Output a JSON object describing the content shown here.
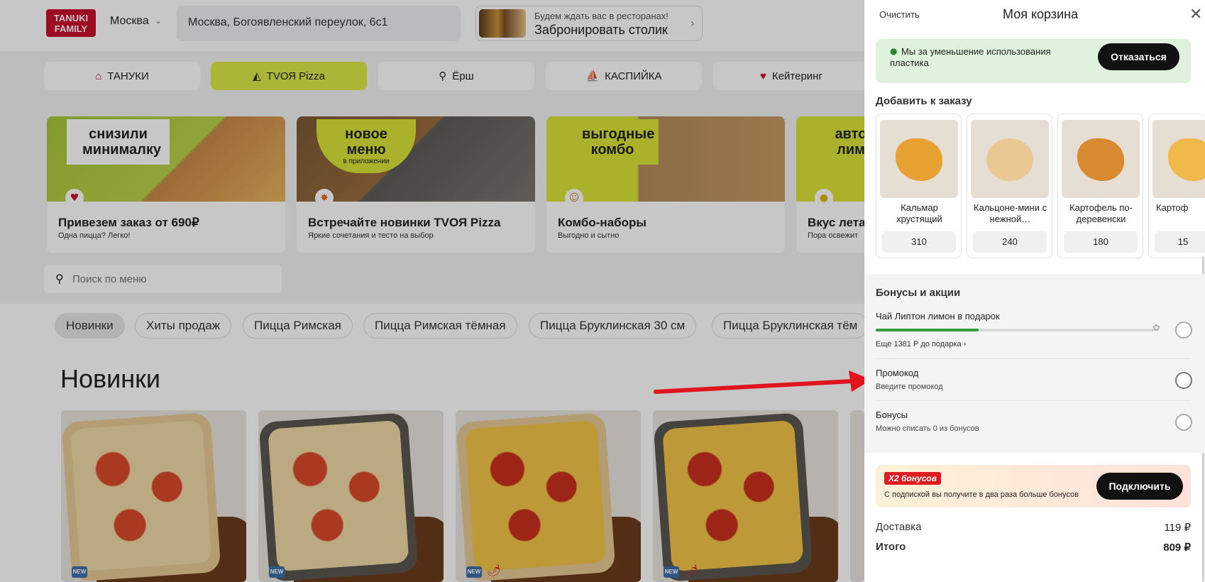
{
  "header": {
    "logo_text": "TANUKI FAMILY",
    "city": "Москва",
    "address": "Москва, Богоявленский переулок, 6с1",
    "booking_line1": "Будем ждать вас в ресторанах!",
    "booking_line2": "Забронировать столик"
  },
  "brands": [
    {
      "label": "ТАНУКИ",
      "icon": "tanuki-icon"
    },
    {
      "label": "TVОЯ Pizza",
      "icon": "pizza-icon",
      "active": true
    },
    {
      "label": "Ёрш",
      "icon": "ersh-icon"
    },
    {
      "label": "КАСПИЙКА",
      "icon": "kaspiyka-icon"
    },
    {
      "label": "Кейтеринг",
      "icon": "heart-icon"
    }
  ],
  "promos": [
    {
      "badge": "снизили минималку",
      "title": "Привезем заказ от 690₽",
      "subtitle": "Одна пицца? Легко!",
      "icon": "heart-icon"
    },
    {
      "badge": "новое меню",
      "badge_sub": "в приложении",
      "title": "Встречайте новинки TVОЯ Pizza",
      "subtitle": "Яркие сочетания и тесто на выбор",
      "icon": "spark-icon"
    },
    {
      "badge": "выгодные комбо",
      "title": "Комбо-наборы",
      "subtitle": "Выгодно и сытно",
      "icon": "smile-icon"
    },
    {
      "badge": "автор лимо",
      "title": "Вкус лета",
      "subtitle": "Пора освежит",
      "icon": "lemon-icon"
    }
  ],
  "menu_search": {
    "placeholder": "Поиск по меню"
  },
  "categories": [
    "Новинки",
    "Хиты продаж",
    "Пицца Римская",
    "Пицца Римская тёмная",
    "Пицца Бруклинская 30 см",
    "Пицца Бруклинская тём"
  ],
  "section_title": "Новинки",
  "new_badge": "NEW",
  "cart": {
    "clear_label": "Очистить",
    "title": "Моя корзина",
    "eco_text": "Мы за уменьшение использования пластика",
    "eco_button": "Отказаться",
    "addons_title": "Добавить к заказу",
    "addons": [
      {
        "name": "Кальмар хрустящий",
        "price": "310"
      },
      {
        "name": "Кальцоне-мини с нежной…",
        "price": "240"
      },
      {
        "name": "Картофель по-деревенски",
        "price": "180"
      },
      {
        "name": "Картоф",
        "price": "15"
      }
    ],
    "bonus_title": "Бонусы и акции",
    "gift_label": "Чай Липтон лимон в подарок",
    "gift_progress": 0.37,
    "gift_remaining": "Еще 1381 Р до подарка",
    "promo_label": "Промокод",
    "promo_sub": "Введите промокод",
    "bonus_label": "Бонусы",
    "bonus_sub": "Можно списать 0 из бонусов",
    "x2_badge": "Х2 бонусов",
    "x2_text": "С подпиской вы получите в два раза больше бонусов",
    "x2_button": "Подключить",
    "delivery_label": "Доставка",
    "delivery_value": "119 ₽",
    "total_label": "Итого",
    "total_value": "809 ₽"
  },
  "colors": {
    "active_brand": "#dbe94a",
    "arrow": "#e0141c",
    "progress": "#2e9e3e",
    "eco_bg": "#dff2dd",
    "logo": "#c8102e"
  }
}
